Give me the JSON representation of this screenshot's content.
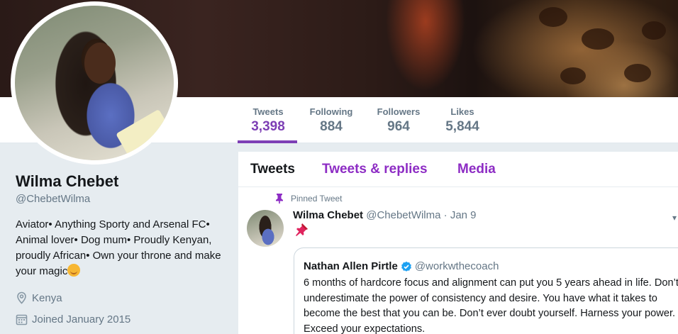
{
  "profile": {
    "name": "Wilma Chebet",
    "handle": "@ChebetWilma",
    "bio": "Aviator• Anything Sporty and Arsenal FC• Animal lover• Dog mum• Proudly Kenyan, proudly African• Own your throne and make your magic",
    "location": "Kenya",
    "joined": "Joined January 2015"
  },
  "stats": [
    {
      "label": "Tweets",
      "value": "3,398"
    },
    {
      "label": "Following",
      "value": "884"
    },
    {
      "label": "Followers",
      "value": "964"
    },
    {
      "label": "Likes",
      "value": "5,844"
    }
  ],
  "tabs": [
    "Tweets",
    "Tweets & replies",
    "Media"
  ],
  "pinned_tweet": {
    "label": "Pinned Tweet",
    "author": "Wilma Chebet",
    "handle": "@ChebetWilma",
    "separator": "·",
    "date": "Jan 9",
    "quoted": {
      "author": "Nathan Allen Pirtle",
      "handle": "@workwthecoach",
      "text": "6 months of hardcore focus and alignment can put you 5 years ahead in life. Don’t underestimate the power of consistency and desire. You have what it takes to become the best that you can be. Don’t ever doubt yourself. Harness your power. Exceed your expectations."
    }
  },
  "colors": {
    "accent": "#7d3fb5",
    "tab_accent": "#8d2cc4",
    "muted": "#657786",
    "verified": "#1da1f2"
  },
  "icons": [
    "location-pin-icon",
    "calendar-icon",
    "pin-icon",
    "pushpin-emoji-icon",
    "verified-badge-icon",
    "smile-emoji-icon",
    "chevron-down-icon"
  ]
}
